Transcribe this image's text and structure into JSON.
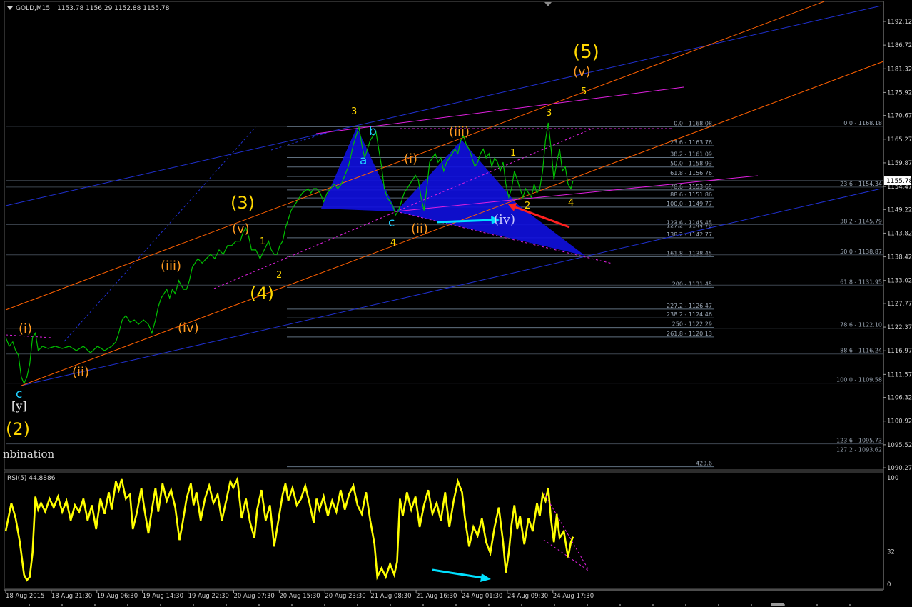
{
  "header": {
    "symbol_label": "GOLD,M15",
    "ohlc": "1153.78 1156.29 1152.88 1155.78"
  },
  "chart_data": {
    "type": "line",
    "title": "GOLD,M15",
    "price_axis": {
      "ticks": [
        "1192.12",
        "1186.72",
        "1181.32",
        "1175.92",
        "1170.67",
        "1165.27",
        "1159.87",
        "1154.47",
        "1149.22",
        "1143.82",
        "1138.42",
        "1133.02",
        "1127.77",
        "1122.37",
        "1116.97",
        "1111.57",
        "1106.32",
        "1100.92",
        "1095.52",
        "1090.27"
      ],
      "ylim": [
        1088.5,
        1196
      ],
      "current_price": "1155.78"
    },
    "time_axis": [
      "18 Aug 2015",
      "18 Aug 21:30",
      "19 Aug 06:30",
      "19 Aug 14:30",
      "19 Aug 22:30",
      "20 Aug 07:30",
      "20 Aug 15:30",
      "20 Aug 23:30",
      "21 Aug 08:30",
      "21 Aug 16:30",
      "24 Aug 01:30",
      "24 Aug 09:30",
      "24 Aug 17:30"
    ],
    "price_path": [
      [
        0,
        1120
      ],
      [
        5,
        1118
      ],
      [
        10,
        1119
      ],
      [
        14,
        1117
      ],
      [
        18,
        1116
      ],
      [
        22,
        1111
      ],
      [
        26,
        1109.5
      ],
      [
        30,
        1111
      ],
      [
        34,
        1114
      ],
      [
        38,
        1120
      ],
      [
        42,
        1121
      ],
      [
        46,
        1117
      ],
      [
        52,
        1118
      ],
      [
        60,
        1117.5
      ],
      [
        70,
        1118
      ],
      [
        80,
        1117.5
      ],
      [
        90,
        1118
      ],
      [
        100,
        1117
      ],
      [
        110,
        1118
      ],
      [
        120,
        1116.5
      ],
      [
        130,
        1118
      ],
      [
        140,
        1117
      ],
      [
        150,
        1118
      ],
      [
        156,
        1119
      ],
      [
        160,
        1121
      ],
      [
        165,
        1124
      ],
      [
        170,
        1125
      ],
      [
        176,
        1123.5
      ],
      [
        182,
        1124
      ],
      [
        188,
        1123
      ],
      [
        195,
        1124
      ],
      [
        202,
        1123
      ],
      [
        207,
        1121
      ],
      [
        212,
        1124
      ],
      [
        216,
        1127
      ],
      [
        220,
        1129
      ],
      [
        224,
        1130
      ],
      [
        228,
        1131
      ],
      [
        232,
        1129
      ],
      [
        236,
        1131
      ],
      [
        240,
        1130
      ],
      [
        245,
        1133
      ],
      [
        248,
        1132
      ],
      [
        252,
        1131
      ],
      [
        256,
        1131
      ],
      [
        260,
        1133
      ],
      [
        264,
        1136
      ],
      [
        268,
        1137
      ],
      [
        272,
        1138
      ],
      [
        278,
        1137
      ],
      [
        284,
        1138
      ],
      [
        290,
        1139
      ],
      [
        296,
        1138
      ],
      [
        302,
        1140
      ],
      [
        308,
        1139
      ],
      [
        314,
        1141
      ],
      [
        320,
        1141
      ],
      [
        326,
        1142
      ],
      [
        332,
        1142
      ],
      [
        336,
        1144
      ],
      [
        340,
        1145
      ],
      [
        344,
        1143
      ],
      [
        348,
        1140
      ],
      [
        354,
        1140
      ],
      [
        360,
        1138
      ],
      [
        366,
        1140
      ],
      [
        372,
        1142
      ],
      [
        376,
        1140
      ],
      [
        380,
        1139
      ],
      [
        384,
        1139
      ],
      [
        388,
        1141
      ],
      [
        392,
        1142
      ],
      [
        396,
        1145
      ],
      [
        400,
        1147
      ],
      [
        404,
        1149
      ],
      [
        408,
        1150
      ],
      [
        412,
        1151
      ],
      [
        416,
        1152
      ],
      [
        420,
        1153
      ],
      [
        424,
        1153.5
      ],
      [
        428,
        1154
      ],
      [
        432,
        1153
      ],
      [
        436,
        1154
      ],
      [
        440,
        1154
      ],
      [
        445,
        1153
      ],
      [
        450,
        1151
      ],
      [
        455,
        1153
      ],
      [
        460,
        1154
      ],
      [
        465,
        1155
      ],
      [
        470,
        1154
      ],
      [
        475,
        1155
      ],
      [
        480,
        1157
      ],
      [
        485,
        1159
      ],
      [
        488,
        1161
      ],
      [
        492,
        1164
      ],
      [
        496,
        1166
      ],
      [
        500,
        1168
      ],
      [
        504,
        1164
      ],
      [
        508,
        1161
      ],
      [
        512,
        1163
      ],
      [
        516,
        1165
      ],
      [
        520,
        1166
      ],
      [
        524,
        1167
      ],
      [
        528,
        1163
      ],
      [
        532,
        1159
      ],
      [
        536,
        1154
      ],
      [
        540,
        1152
      ],
      [
        544,
        1151
      ],
      [
        548,
        1150
      ],
      [
        552,
        1148
      ],
      [
        556,
        1149
      ],
      [
        560,
        1151
      ],
      [
        564,
        1153
      ],
      [
        568,
        1154
      ],
      [
        572,
        1155
      ],
      [
        576,
        1156
      ],
      [
        580,
        1157
      ],
      [
        584,
        1156
      ],
      [
        588,
        1152
      ],
      [
        592,
        1149
      ],
      [
        596,
        1154
      ],
      [
        600,
        1160
      ],
      [
        604,
        1161
      ],
      [
        608,
        1162
      ],
      [
        612,
        1160
      ],
      [
        616,
        1161
      ],
      [
        620,
        1158
      ],
      [
        624,
        1160
      ],
      [
        628,
        1161
      ],
      [
        632,
        1162
      ],
      [
        636,
        1163
      ],
      [
        640,
        1162
      ],
      [
        644,
        1165
      ],
      [
        648,
        1166
      ],
      [
        652,
        1164
      ],
      [
        656,
        1163
      ],
      [
        660,
        1161
      ],
      [
        664,
        1159
      ],
      [
        668,
        1160
      ],
      [
        672,
        1162
      ],
      [
        676,
        1163
      ],
      [
        680,
        1161
      ],
      [
        684,
        1162
      ],
      [
        688,
        1159
      ],
      [
        692,
        1161
      ],
      [
        696,
        1160
      ],
      [
        700,
        1158
      ],
      [
        704,
        1160
      ],
      [
        708,
        1155
      ],
      [
        712,
        1152
      ],
      [
        716,
        1154
      ],
      [
        720,
        1158
      ],
      [
        724,
        1156
      ],
      [
        728,
        1154
      ],
      [
        732,
        1152
      ],
      [
        736,
        1154
      ],
      [
        740,
        1153
      ],
      [
        744,
        1152
      ],
      [
        748,
        1155
      ],
      [
        752,
        1153
      ],
      [
        756,
        1154
      ],
      [
        760,
        1158
      ],
      [
        764,
        1165
      ],
      [
        768,
        1169
      ],
      [
        772,
        1163
      ],
      [
        776,
        1156
      ],
      [
        780,
        1160
      ],
      [
        784,
        1163
      ],
      [
        788,
        1158
      ],
      [
        792,
        1159
      ],
      [
        796,
        1155
      ],
      [
        800,
        1154
      ],
      [
        803,
        1155.78
      ]
    ],
    "rsi": {
      "label": "RSI(5) 44.8886",
      "scale_labels": [
        "100",
        "32",
        "0"
      ],
      "ylim": [
        0,
        100
      ],
      "values": [
        [
          0,
          50
        ],
        [
          8,
          76
        ],
        [
          14,
          62
        ],
        [
          20,
          40
        ],
        [
          26,
          10
        ],
        [
          30,
          5
        ],
        [
          34,
          8
        ],
        [
          38,
          30
        ],
        [
          42,
          82
        ],
        [
          46,
          70
        ],
        [
          50,
          76
        ],
        [
          56,
          68
        ],
        [
          62,
          80
        ],
        [
          68,
          72
        ],
        [
          74,
          82
        ],
        [
          80,
          68
        ],
        [
          86,
          78
        ],
        [
          92,
          60
        ],
        [
          98,
          74
        ],
        [
          104,
          68
        ],
        [
          110,
          80
        ],
        [
          116,
          60
        ],
        [
          122,
          74
        ],
        [
          128,
          52
        ],
        [
          134,
          80
        ],
        [
          140,
          66
        ],
        [
          146,
          86
        ],
        [
          150,
          70
        ],
        [
          156,
          96
        ],
        [
          160,
          88
        ],
        [
          164,
          98
        ],
        [
          170,
          80
        ],
        [
          176,
          84
        ],
        [
          180,
          52
        ],
        [
          186,
          68
        ],
        [
          192,
          90
        ],
        [
          196,
          72
        ],
        [
          202,
          48
        ],
        [
          206,
          66
        ],
        [
          212,
          90
        ],
        [
          216,
          68
        ],
        [
          222,
          94
        ],
        [
          228,
          78
        ],
        [
          234,
          88
        ],
        [
          240,
          72
        ],
        [
          246,
          42
        ],
        [
          250,
          56
        ],
        [
          256,
          80
        ],
        [
          262,
          94
        ],
        [
          266,
          74
        ],
        [
          270,
          86
        ],
        [
          276,
          60
        ],
        [
          282,
          80
        ],
        [
          288,
          92
        ],
        [
          294,
          76
        ],
        [
          300,
          84
        ],
        [
          306,
          60
        ],
        [
          312,
          78
        ],
        [
          318,
          96
        ],
        [
          322,
          90
        ],
        [
          328,
          98
        ],
        [
          334,
          62
        ],
        [
          340,
          80
        ],
        [
          346,
          58
        ],
        [
          352,
          44
        ],
        [
          356,
          70
        ],
        [
          362,
          88
        ],
        [
          368,
          60
        ],
        [
          374,
          74
        ],
        [
          380,
          36
        ],
        [
          386,
          60
        ],
        [
          392,
          84
        ],
        [
          396,
          94
        ],
        [
          400,
          78
        ],
        [
          406,
          90
        ],
        [
          412,
          74
        ],
        [
          418,
          80
        ],
        [
          424,
          92
        ],
        [
          430,
          76
        ],
        [
          436,
          58
        ],
        [
          440,
          80
        ],
        [
          444,
          70
        ],
        [
          450,
          82
        ],
        [
          456,
          64
        ],
        [
          462,
          78
        ],
        [
          468,
          68
        ],
        [
          474,
          88
        ],
        [
          480,
          70
        ],
        [
          486,
          84
        ],
        [
          492,
          92
        ],
        [
          498,
          74
        ],
        [
          504,
          66
        ],
        [
          510,
          86
        ],
        [
          516,
          60
        ],
        [
          522,
          38
        ],
        [
          526,
          8
        ],
        [
          532,
          16
        ],
        [
          538,
          8
        ],
        [
          544,
          20
        ],
        [
          550,
          10
        ],
        [
          554,
          22
        ],
        [
          558,
          80
        ],
        [
          562,
          64
        ],
        [
          568,
          86
        ],
        [
          574,
          70
        ],
        [
          580,
          82
        ],
        [
          586,
          54
        ],
        [
          592,
          74
        ],
        [
          598,
          88
        ],
        [
          604,
          66
        ],
        [
          610,
          76
        ],
        [
          616,
          60
        ],
        [
          622,
          86
        ],
        [
          628,
          54
        ],
        [
          634,
          78
        ],
        [
          640,
          96
        ],
        [
          646,
          86
        ],
        [
          650,
          62
        ],
        [
          656,
          36
        ],
        [
          662,
          54
        ],
        [
          668,
          46
        ],
        [
          674,
          62
        ],
        [
          680,
          40
        ],
        [
          686,
          30
        ],
        [
          692,
          54
        ],
        [
          698,
          72
        ],
        [
          704,
          40
        ],
        [
          708,
          12
        ],
        [
          712,
          30
        ],
        [
          716,
          56
        ],
        [
          720,
          74
        ],
        [
          724,
          52
        ],
        [
          728,
          64
        ],
        [
          734,
          38
        ],
        [
          740,
          62
        ],
        [
          746,
          50
        ],
        [
          752,
          76
        ],
        [
          756,
          64
        ],
        [
          760,
          84
        ],
        [
          764,
          78
        ],
        [
          768,
          90
        ],
        [
          772,
          60
        ],
        [
          776,
          40
        ],
        [
          780,
          66
        ],
        [
          784,
          44
        ],
        [
          790,
          50
        ],
        [
          796,
          26
        ],
        [
          800,
          40
        ],
        [
          803,
          45
        ]
      ]
    },
    "fib_left": [
      {
        "label": "0.0 - 1168.08",
        "price": 1168.08
      },
      {
        "label": "23.6 - 1163.76",
        "price": 1163.76
      },
      {
        "label": "38.2 - 1161.09",
        "price": 1161.09
      },
      {
        "label": "50.0 - 1158.93",
        "price": 1158.93
      },
      {
        "label": "61.8 - 1156.76",
        "price": 1156.76
      },
      {
        "label": "78.6 - 1153.69",
        "price": 1153.69
      },
      {
        "label": "88.6 - 1151.86",
        "price": 1151.86
      },
      {
        "label": "100.0 - 1149.77",
        "price": 1149.77
      },
      {
        "label": "123.6 - 1145.45",
        "price": 1145.45
      },
      {
        "label": "127.2 - 1144.79",
        "price": 1144.79
      },
      {
        "label": "138.2 - 1142.77",
        "price": 1142.77
      },
      {
        "label": "161.8 - 1138.45",
        "price": 1138.45
      },
      {
        "label": "200 - 1131.45",
        "price": 1131.45
      },
      {
        "label": "227.2 - 1126.47",
        "price": 1126.47
      },
      {
        "label": "238.2 - 1124.46",
        "price": 1124.46
      },
      {
        "label": "250 - 1122.29",
        "price": 1122.29
      },
      {
        "label": "261.8 - 1120.13",
        "price": 1120.13
      },
      {
        "label": "423.6",
        "price": 1090.5
      }
    ],
    "fib_right": [
      {
        "label": "0.0 - 1168.18",
        "price": 1168.18
      },
      {
        "label": "23.6 - 1154.34",
        "price": 1154.34
      },
      {
        "label": "38.2 - 1145.79",
        "price": 1145.79
      },
      {
        "label": "50.0 - 1138.87",
        "price": 1138.87
      },
      {
        "label": "61.8 - 1131.95",
        "price": 1131.95
      },
      {
        "label": "78.6 - 1122.10",
        "price": 1122.1
      },
      {
        "label": "88.6 - 1116.24",
        "price": 1116.24
      },
      {
        "label": "100.0 - 1109.58",
        "price": 1109.58
      },
      {
        "label": "123.6 - 1095.73",
        "price": 1095.73
      },
      {
        "label": "127.2 - 1093.62",
        "price": 1093.62
      }
    ],
    "wave_labels_yellow": [
      "(5)",
      "(3)",
      "(4)",
      "(2)",
      "3",
      "5",
      "1",
      "2",
      "1",
      "3",
      "4",
      "2",
      "4"
    ],
    "wave_labels_orange": [
      "(v)",
      "(v)",
      "(iii)",
      "(iv)",
      "(i)",
      "(ii)",
      "(i)",
      "(ii)",
      "(iii)"
    ],
    "wave_labels_cyan": [
      "b",
      "a",
      "c",
      "c"
    ],
    "wave_labels_lavender": [
      "(iv)"
    ],
    "wave_labels_white": [
      "[y]"
    ],
    "annotation_text": "nbination",
    "colors": {
      "price": "#00c000",
      "rsi": "#ffff00",
      "fib": "#607080",
      "blue_channel": "#2030d0",
      "orange_channel": "#ff6000",
      "magenta": "#e020e0",
      "triangle": "#1010e0",
      "cyan_arrow": "#00e0ff",
      "red_arrow": "#ff2020",
      "yellow_label": "#ffd700",
      "orange_label": "#ff9a20",
      "cyan_label": "#20d0ff"
    }
  }
}
